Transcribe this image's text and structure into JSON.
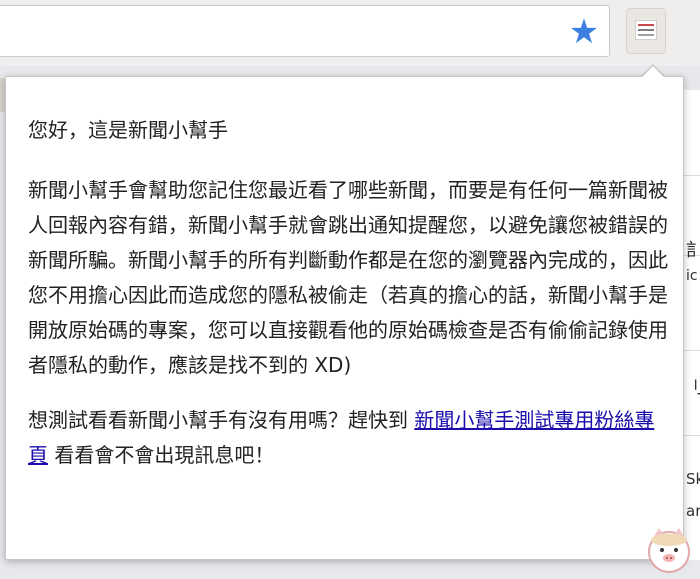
{
  "browser": {
    "bookmark_icon": "star-icon",
    "extension_icon": "news-helper-extension-icon"
  },
  "popup": {
    "greeting": "您好，這是新聞小幫手",
    "description": "新聞小幫手會幫助您記住您最近看了哪些新聞，而要是有任何一篇新聞被人回報內容有錯，新聞小幫手就會跳出通知提醒您，以避免讓您被錯誤的新聞所騙。新聞小幫手的所有判斷動作都是在您的瀏覽器內完成的，因此您不用擔心因此而造成您的隱私被偷走（若真的擔心的話，新聞小幫手是開放原始碼的專案，您可以直接觀看他的原始碼檢查是否有偷偷記錄使用者隱私的動作，應該是找不到的 XD)",
    "cta_prefix": "想測試看看新聞小幫手有沒有用嗎？趕快到 ",
    "cta_link": "新聞小幫手測試專用粉絲專頁",
    "cta_suffix": " 看看會不會出現訊息吧！"
  },
  "background_fragments": [
    "訁",
    "ic",
    "刂",
    "Sk",
    "ar"
  ],
  "colors": {
    "accent_star": "#3b7fe0",
    "link": "#1a0dab"
  }
}
